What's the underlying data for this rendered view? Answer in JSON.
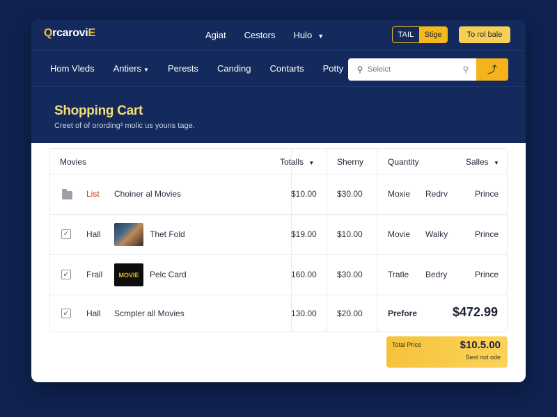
{
  "brand": {
    "logo_prefix": "Q",
    "logo_rest": "rcarovi",
    "logo_suffix": "E"
  },
  "topnav": {
    "links": [
      {
        "label": "Agiat"
      },
      {
        "label": "Cestors"
      },
      {
        "label": "Hulo",
        "has_caret": true
      }
    ],
    "toggle": {
      "left": "TAIL",
      "right": "Stige"
    },
    "cta": "To rol bale"
  },
  "mainnav": {
    "items": [
      {
        "label": "Hom Vleds"
      },
      {
        "label": "Antiers",
        "has_caret": true
      },
      {
        "label": "Perests"
      },
      {
        "label": "Canding"
      },
      {
        "label": "Contarts"
      },
      {
        "label": "Potty"
      }
    ]
  },
  "search": {
    "placeholder": "Seleict",
    "go_icon": "arrow-icon"
  },
  "hero": {
    "title": "Shopping Cart",
    "subtitle": "Creet of of orording³ molic us youns tage."
  },
  "table": {
    "headers": {
      "movies": "Movies",
      "totals": "Totalls",
      "sherny": "Sherny",
      "quantity": "Quantity",
      "salles": "Salles"
    },
    "rows": [
      {
        "icon": "folder-icon",
        "tag": "List",
        "tag_color": "#c0392b",
        "thumb": "",
        "title": "Choiner al Movies",
        "total": "$10.00",
        "sherny": "$30.00",
        "q1": "Moxie",
        "q2": "Redrv",
        "sale": "Prince"
      },
      {
        "icon": "checkbox-checked-icon",
        "tag": "Hall",
        "tag_color": "#2a3040",
        "thumb": "photo",
        "title": "Thet Fold",
        "total": "$19.00",
        "sherny": "$10.00",
        "q1": "Movie",
        "q2": "Walky",
        "sale": "Prince"
      },
      {
        "icon": "checkbox-arrow-icon",
        "tag": "Frall",
        "tag_color": "#2a3040",
        "thumb": "movie",
        "thumb_label": "MOVIE",
        "title": "Pelc Card",
        "total": "160.00",
        "sherny": "$30.00",
        "q1": "Tratle",
        "q2": "Bedry",
        "sale": "Prince"
      },
      {
        "icon": "checkbox-arrow-icon",
        "tag": "Hall",
        "tag_color": "#2a3040",
        "thumb": "",
        "title": "Scmpler all Movies",
        "total": "130.00",
        "sherny": "$20.00",
        "q1": "Prefore",
        "big_price": "$472.99"
      }
    ]
  },
  "total_box": {
    "label": "Total Price",
    "value": "$10.5.00",
    "sub": "Sest not ode"
  }
}
